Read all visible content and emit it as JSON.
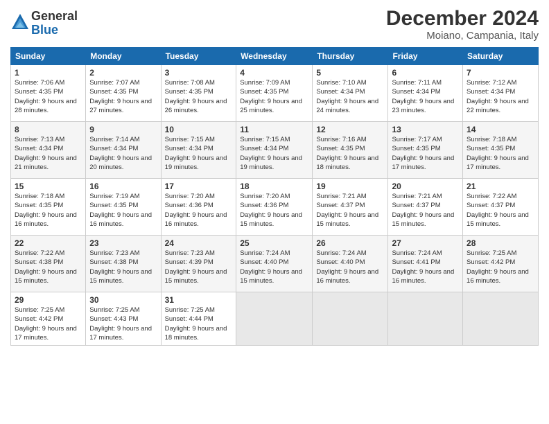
{
  "logo": {
    "general": "General",
    "blue": "Blue"
  },
  "title": "December 2024",
  "location": "Moiano, Campania, Italy",
  "days_header": [
    "Sunday",
    "Monday",
    "Tuesday",
    "Wednesday",
    "Thursday",
    "Friday",
    "Saturday"
  ],
  "weeks": [
    [
      {
        "num": "1",
        "sunrise": "7:06 AM",
        "sunset": "4:35 PM",
        "daylight": "9 hours and 28 minutes."
      },
      {
        "num": "2",
        "sunrise": "7:07 AM",
        "sunset": "4:35 PM",
        "daylight": "9 hours and 27 minutes."
      },
      {
        "num": "3",
        "sunrise": "7:08 AM",
        "sunset": "4:35 PM",
        "daylight": "9 hours and 26 minutes."
      },
      {
        "num": "4",
        "sunrise": "7:09 AM",
        "sunset": "4:35 PM",
        "daylight": "9 hours and 25 minutes."
      },
      {
        "num": "5",
        "sunrise": "7:10 AM",
        "sunset": "4:34 PM",
        "daylight": "9 hours and 24 minutes."
      },
      {
        "num": "6",
        "sunrise": "7:11 AM",
        "sunset": "4:34 PM",
        "daylight": "9 hours and 23 minutes."
      },
      {
        "num": "7",
        "sunrise": "7:12 AM",
        "sunset": "4:34 PM",
        "daylight": "9 hours and 22 minutes."
      }
    ],
    [
      {
        "num": "8",
        "sunrise": "7:13 AM",
        "sunset": "4:34 PM",
        "daylight": "9 hours and 21 minutes."
      },
      {
        "num": "9",
        "sunrise": "7:14 AM",
        "sunset": "4:34 PM",
        "daylight": "9 hours and 20 minutes."
      },
      {
        "num": "10",
        "sunrise": "7:15 AM",
        "sunset": "4:34 PM",
        "daylight": "9 hours and 19 minutes."
      },
      {
        "num": "11",
        "sunrise": "7:15 AM",
        "sunset": "4:34 PM",
        "daylight": "9 hours and 19 minutes."
      },
      {
        "num": "12",
        "sunrise": "7:16 AM",
        "sunset": "4:35 PM",
        "daylight": "9 hours and 18 minutes."
      },
      {
        "num": "13",
        "sunrise": "7:17 AM",
        "sunset": "4:35 PM",
        "daylight": "9 hours and 17 minutes."
      },
      {
        "num": "14",
        "sunrise": "7:18 AM",
        "sunset": "4:35 PM",
        "daylight": "9 hours and 17 minutes."
      }
    ],
    [
      {
        "num": "15",
        "sunrise": "7:18 AM",
        "sunset": "4:35 PM",
        "daylight": "9 hours and 16 minutes."
      },
      {
        "num": "16",
        "sunrise": "7:19 AM",
        "sunset": "4:35 PM",
        "daylight": "9 hours and 16 minutes."
      },
      {
        "num": "17",
        "sunrise": "7:20 AM",
        "sunset": "4:36 PM",
        "daylight": "9 hours and 16 minutes."
      },
      {
        "num": "18",
        "sunrise": "7:20 AM",
        "sunset": "4:36 PM",
        "daylight": "9 hours and 15 minutes."
      },
      {
        "num": "19",
        "sunrise": "7:21 AM",
        "sunset": "4:37 PM",
        "daylight": "9 hours and 15 minutes."
      },
      {
        "num": "20",
        "sunrise": "7:21 AM",
        "sunset": "4:37 PM",
        "daylight": "9 hours and 15 minutes."
      },
      {
        "num": "21",
        "sunrise": "7:22 AM",
        "sunset": "4:37 PM",
        "daylight": "9 hours and 15 minutes."
      }
    ],
    [
      {
        "num": "22",
        "sunrise": "7:22 AM",
        "sunset": "4:38 PM",
        "daylight": "9 hours and 15 minutes."
      },
      {
        "num": "23",
        "sunrise": "7:23 AM",
        "sunset": "4:38 PM",
        "daylight": "9 hours and 15 minutes."
      },
      {
        "num": "24",
        "sunrise": "7:23 AM",
        "sunset": "4:39 PM",
        "daylight": "9 hours and 15 minutes."
      },
      {
        "num": "25",
        "sunrise": "7:24 AM",
        "sunset": "4:40 PM",
        "daylight": "9 hours and 15 minutes."
      },
      {
        "num": "26",
        "sunrise": "7:24 AM",
        "sunset": "4:40 PM",
        "daylight": "9 hours and 16 minutes."
      },
      {
        "num": "27",
        "sunrise": "7:24 AM",
        "sunset": "4:41 PM",
        "daylight": "9 hours and 16 minutes."
      },
      {
        "num": "28",
        "sunrise": "7:25 AM",
        "sunset": "4:42 PM",
        "daylight": "9 hours and 16 minutes."
      }
    ],
    [
      {
        "num": "29",
        "sunrise": "7:25 AM",
        "sunset": "4:42 PM",
        "daylight": "9 hours and 17 minutes."
      },
      {
        "num": "30",
        "sunrise": "7:25 AM",
        "sunset": "4:43 PM",
        "daylight": "9 hours and 17 minutes."
      },
      {
        "num": "31",
        "sunrise": "7:25 AM",
        "sunset": "4:44 PM",
        "daylight": "9 hours and 18 minutes."
      },
      null,
      null,
      null,
      null
    ]
  ],
  "labels": {
    "sunrise": "Sunrise: ",
    "sunset": "Sunset: ",
    "daylight": "Daylight: "
  }
}
